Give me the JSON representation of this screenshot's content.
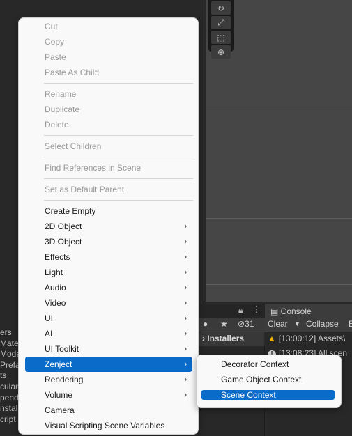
{
  "context_menu": {
    "items": [
      {
        "label": "Cut",
        "enabled": false
      },
      {
        "label": "Copy",
        "enabled": false
      },
      {
        "label": "Paste",
        "enabled": false
      },
      {
        "label": "Paste As Child",
        "enabled": false
      },
      {
        "label": "Rename",
        "enabled": false
      },
      {
        "label": "Duplicate",
        "enabled": false
      },
      {
        "label": "Delete",
        "enabled": false
      },
      {
        "label": "Select Children",
        "enabled": false
      },
      {
        "label": "Find References in Scene",
        "enabled": false
      },
      {
        "label": "Set as Default Parent",
        "enabled": false
      },
      {
        "label": "Create Empty",
        "enabled": true
      },
      {
        "label": "2D Object",
        "enabled": true,
        "submenu": true
      },
      {
        "label": "3D Object",
        "enabled": true,
        "submenu": true
      },
      {
        "label": "Effects",
        "enabled": true,
        "submenu": true
      },
      {
        "label": "Light",
        "enabled": true,
        "submenu": true
      },
      {
        "label": "Audio",
        "enabled": true,
        "submenu": true
      },
      {
        "label": "Video",
        "enabled": true,
        "submenu": true
      },
      {
        "label": "UI",
        "enabled": true,
        "submenu": true
      },
      {
        "label": "AI",
        "enabled": true,
        "submenu": true
      },
      {
        "label": "UI Toolkit",
        "enabled": true,
        "submenu": true
      },
      {
        "label": "Zenject",
        "enabled": true,
        "submenu": true,
        "selected": true
      },
      {
        "label": "Rendering",
        "enabled": true,
        "submenu": true
      },
      {
        "label": "Volume",
        "enabled": true,
        "submenu": true
      },
      {
        "label": "Camera",
        "enabled": true
      },
      {
        "label": "Visual Scripting Scene Variables",
        "enabled": true
      }
    ]
  },
  "zenject_submenu": {
    "items": [
      {
        "label": "Decorator Context"
      },
      {
        "label": "Game Object Context"
      },
      {
        "label": "Scene Context",
        "selected": true
      }
    ]
  },
  "background": {
    "hierarchy_fragments": [
      "ers",
      "Mate",
      "Mode",
      "Prefa",
      "",
      "ts",
      "cular",
      "pend",
      "nstal",
      "cript"
    ],
    "panel": {
      "console_tab": "Console",
      "hidden_count": "31",
      "clear_label": "Clear",
      "collapse_label": "Collapse",
      "extra_label": "E",
      "breadcrumb": "Installers",
      "console_lines": [
        {
          "type": "warning",
          "text": "[13:00:12] Assets\\"
        },
        {
          "type": "info",
          "text": "[13:08:23] All scen"
        }
      ]
    },
    "colors": {
      "selection": "#0a6bc9",
      "menu_bg": "#f9f9f9",
      "warning": "#f0b400"
    }
  }
}
